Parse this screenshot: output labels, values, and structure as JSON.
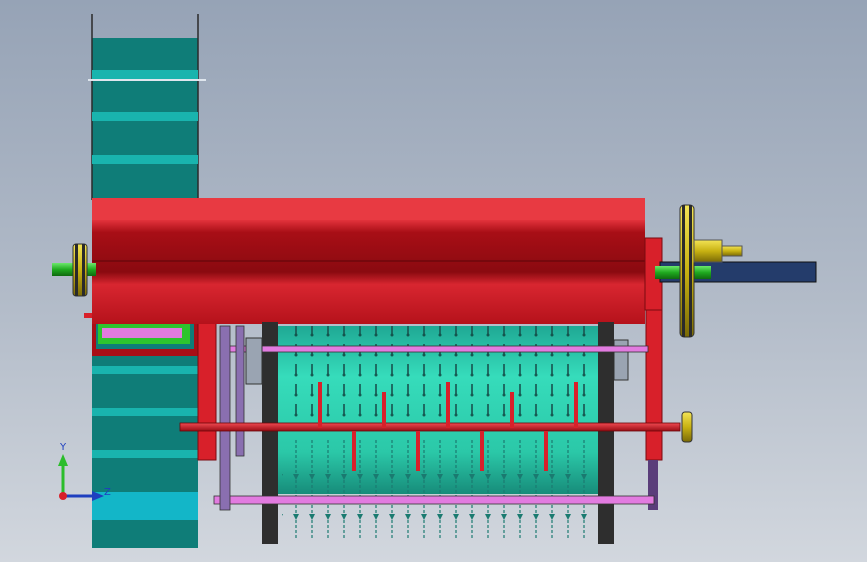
{
  "view": {
    "background_top": "#96a3b6",
    "background_bottom": "#d2d7de"
  },
  "triad": {
    "y_label": "Y",
    "z_label": "Z",
    "y_color": "#2bbd2b",
    "z_color": "#1e3fbf",
    "origin_color": "#d8202a"
  },
  "colors": {
    "housing_red": "#d8202a",
    "housing_dark": "#8c0a10",
    "conveyor_teal": "#0f7d78",
    "conveyor_cleat": "#19b4ae",
    "drum_teal": "#2ed3b0",
    "shaft_green": "#2ec42e",
    "pulley_yellow": "#d8c81e",
    "beam_navy": "#243c6b",
    "frame_pink": "#e27be0",
    "frame_dark": "#3a3a3a"
  }
}
